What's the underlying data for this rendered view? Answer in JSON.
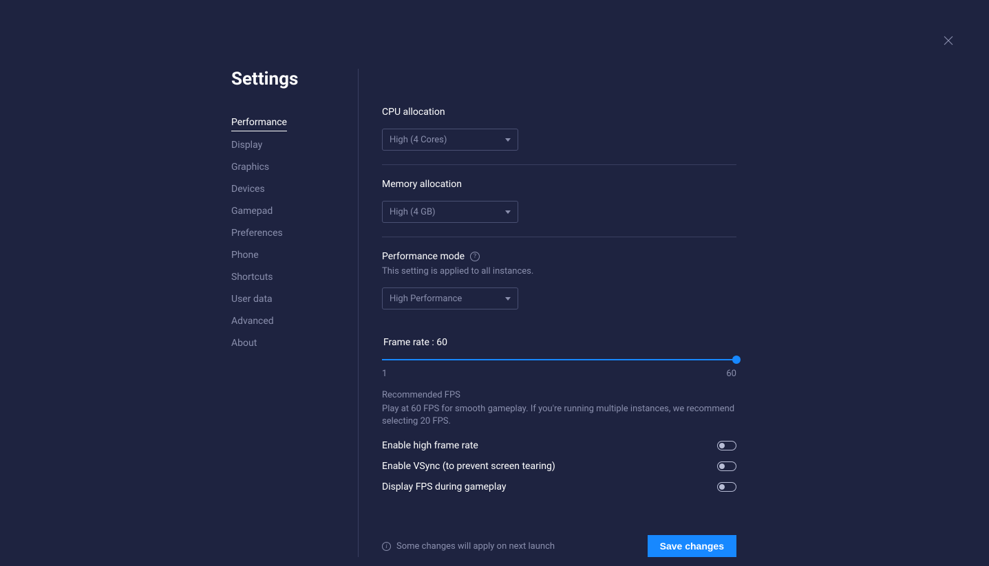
{
  "title": "Settings",
  "sidebar": {
    "items": [
      {
        "label": "Performance",
        "active": true
      },
      {
        "label": "Display"
      },
      {
        "label": "Graphics"
      },
      {
        "label": "Devices"
      },
      {
        "label": "Gamepad"
      },
      {
        "label": "Preferences"
      },
      {
        "label": "Phone"
      },
      {
        "label": "Shortcuts"
      },
      {
        "label": "User data"
      },
      {
        "label": "Advanced"
      },
      {
        "label": "About"
      }
    ]
  },
  "cpu": {
    "label": "CPU allocation",
    "value": "High (4 Cores)"
  },
  "memory": {
    "label": "Memory allocation",
    "value": "High (4 GB)"
  },
  "perfmode": {
    "label": "Performance mode",
    "note": "This setting is applied to all instances.",
    "value": "High Performance"
  },
  "framerate": {
    "label_prefix": "Frame rate : ",
    "value": "60",
    "min": "1",
    "max": "60",
    "rec_title": "Recommended FPS",
    "rec_body": "Play at 60 FPS for smooth gameplay. If you're running multiple instances, we recommend selecting 20 FPS."
  },
  "toggles": {
    "high_fps": {
      "label": "Enable high frame rate",
      "on": false
    },
    "vsync": {
      "label": "Enable VSync (to prevent screen tearing)",
      "on": false
    },
    "show_fps": {
      "label": "Display FPS during gameplay",
      "on": false
    }
  },
  "footer": {
    "note": "Some changes will apply on next launch",
    "save": "Save changes"
  }
}
